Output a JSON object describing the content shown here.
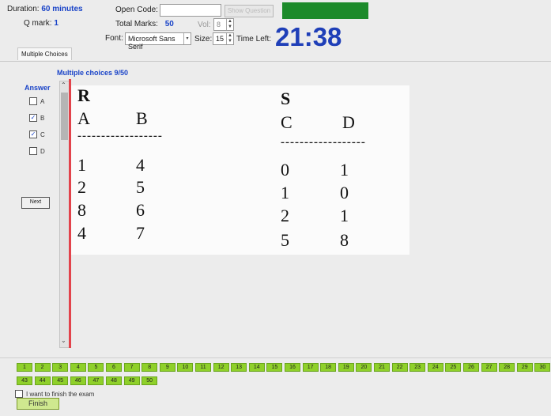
{
  "header": {
    "duration_label": "Duration:",
    "duration_value": "60 minutes",
    "open_code_label": "Open Code:",
    "open_code_value": "",
    "show_question_label": "Show Question",
    "q_mark_label": "Q mark:",
    "q_mark_value": "1",
    "total_marks_label": "Total Marks:",
    "total_marks_value": "50",
    "vol_label": "Vol:",
    "vol_value": "8",
    "font_label": "Font:",
    "font_value": "Microsoft Sans Serif",
    "size_label": "Size:",
    "size_value": "15",
    "time_left_label": "Time Left:",
    "time_left_value": "21:38",
    "status_color": "#1c8a2a"
  },
  "tab": {
    "label": "Multiple Choices"
  },
  "question": {
    "progress_label": "Multiple choices 9/50"
  },
  "answer": {
    "title": "Answer",
    "options": [
      {
        "label": "A",
        "checked": false
      },
      {
        "label": "B",
        "checked": true
      },
      {
        "label": "C",
        "checked": true
      },
      {
        "label": "D",
        "checked": false
      }
    ],
    "next_label": "Next"
  },
  "content": {
    "left_title": "R",
    "left_headers": [
      "A",
      "B"
    ],
    "left_rows": [
      [
        "1",
        "4"
      ],
      [
        "2",
        "5"
      ],
      [
        "8",
        "6"
      ],
      [
        "4",
        "7"
      ]
    ],
    "right_title": "S",
    "right_headers": [
      "C",
      "D"
    ],
    "right_rows": [
      [
        "0",
        "1"
      ],
      [
        "1",
        "0"
      ],
      [
        "2",
        "1"
      ],
      [
        "5",
        "8"
      ]
    ],
    "separator": "------------------"
  },
  "navigator": {
    "row1": [
      "1",
      "2",
      "3",
      "4",
      "5",
      "6",
      "7",
      "8",
      "9",
      "10",
      "11",
      "12",
      "13",
      "14",
      "15",
      "16",
      "17",
      "18",
      "19",
      "20",
      "21",
      "22",
      "23",
      "24",
      "25",
      "26",
      "27",
      "28",
      "29",
      "30"
    ],
    "row2": [
      "43",
      "44",
      "45",
      "46",
      "47",
      "48",
      "49",
      "50"
    ]
  },
  "footer": {
    "finish_checkbox_label": "I want to finish the exam",
    "finish_label": "Finish"
  }
}
